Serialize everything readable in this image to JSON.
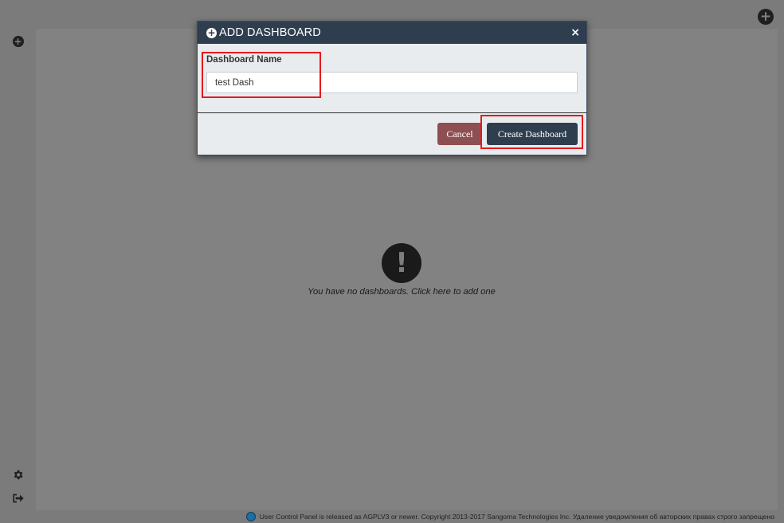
{
  "top_add_icon": "plus-circle-icon",
  "sidebar": {
    "add_icon": "plus-circle-icon",
    "settings_icon": "gear-icon",
    "logout_icon": "sign-out-icon"
  },
  "empty_state": {
    "icon": "exclamation-circle-icon",
    "text": "You have no dashboards. Click here to add one"
  },
  "modal": {
    "title_icon": "plus-circle-icon",
    "title": "ADD DASHBOARD",
    "close_label": "×",
    "field_label": "Dashboard Name",
    "field_value": "test Dash",
    "cancel_label": "Cancel",
    "create_label": "Create Dashboard"
  },
  "footer": {
    "text": "User Control Panel is released as AGPLV3 or newer. Copyright 2013-2017 Sangoma Technologies Inc. Удаление уведомления об авторских правах строго запрещено"
  },
  "colors": {
    "modal_header": "#2e3e4e",
    "cancel_button": "#8e4f52",
    "create_button": "#2e3e4e",
    "highlight": "#e6191d"
  }
}
